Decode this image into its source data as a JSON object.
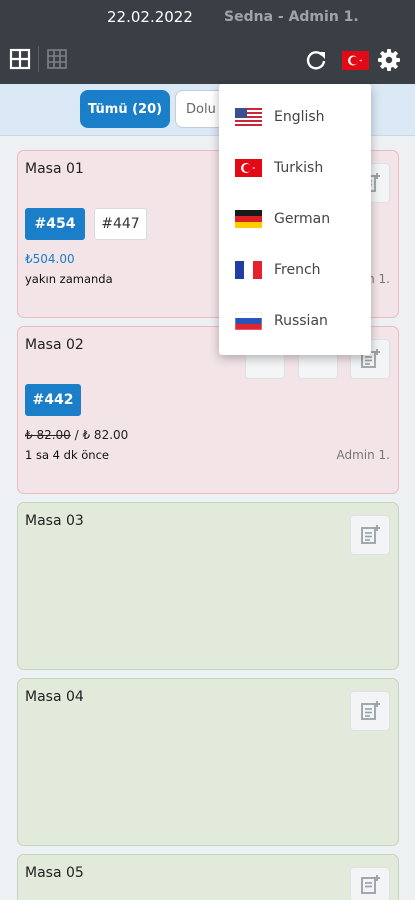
{
  "status_bar": {
    "date": "22.02.2022",
    "user": "Sedna - Admin 1."
  },
  "toolbar": {
    "icons": [
      "grid-large-icon",
      "grid-small-icon",
      "refresh-icon",
      "turkey-flag-icon",
      "gear-icon"
    ]
  },
  "filters": {
    "all_label": "Tümü (20)",
    "full_label": "Dolu"
  },
  "tables": [
    {
      "name": "Masa 01",
      "status": "occupied",
      "orders": [
        "#454",
        "#447"
      ],
      "price": "₺504.00",
      "time": "yakın zamanda",
      "admin": "Admin 1."
    },
    {
      "name": "Masa 02",
      "status": "occupied",
      "orders": [
        "#442"
      ],
      "price_old": "₺ 82.00",
      "price_sep": " / ",
      "price_new": "₺ 82.00",
      "time": "1 sa 4 dk önce",
      "admin": "Admin 1."
    },
    {
      "name": "Masa 03",
      "status": "free"
    },
    {
      "name": "Masa 04",
      "status": "free"
    },
    {
      "name": "Masa 05",
      "status": "free"
    }
  ],
  "language_menu": {
    "items": [
      {
        "label": "English",
        "icon": "us-flag-icon"
      },
      {
        "label": "Turkish",
        "icon": "turkey-flag-icon"
      },
      {
        "label": "German",
        "icon": "germany-flag-icon"
      },
      {
        "label": "French",
        "icon": "france-flag-icon"
      },
      {
        "label": "Russian",
        "icon": "russia-flag-icon"
      }
    ]
  },
  "colors": {
    "topbar": "#3a3f45",
    "accent": "#1a7ec8",
    "occupied_bg": "#f3e4e8",
    "occupied_border": "#f1b7c2",
    "free_bg": "#e1eadb",
    "free_border": "#c2d8bd"
  }
}
